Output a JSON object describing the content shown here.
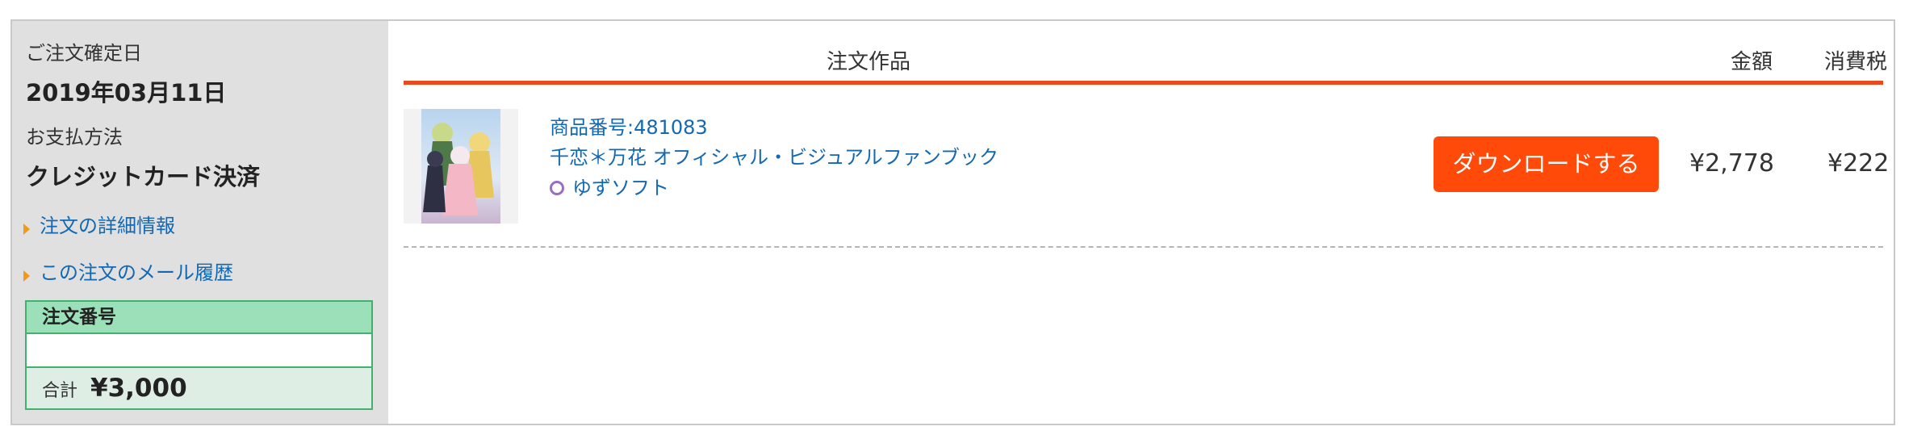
{
  "sidebar": {
    "confirm_date_label": "ご注文確定日",
    "confirm_date_value": "2019年03月11日",
    "payment_label": "お支払方法",
    "payment_value": "クレジットカード決済",
    "links": [
      {
        "label": "注文の詳細情報"
      },
      {
        "label": "この注文のメール履歴"
      }
    ],
    "order_box": {
      "header": "注文番号",
      "order_number": "",
      "total_label": "合計",
      "total_value": "¥3,000"
    }
  },
  "table": {
    "headers": {
      "product": "注文作品",
      "price": "金額",
      "tax": "消費税"
    },
    "items": [
      {
        "product_code": "商品番号:481083",
        "title": "千恋＊万花 オフィシャル・ビジュアルファンブック",
        "maker": "ゆずソフト",
        "download_label": "ダウンロードする",
        "price": "¥2,778",
        "tax": "¥222"
      }
    ]
  },
  "colors": {
    "accent_orange": "#e8491d",
    "button_orange": "#ff4a0a",
    "link_blue": "#1268b3",
    "order_green": "#3fb36c",
    "sidebar_gray": "#e0e0e0"
  },
  "icons": {
    "link_bullet": "triangle-right-icon",
    "maker": "circle-ring-icon"
  }
}
